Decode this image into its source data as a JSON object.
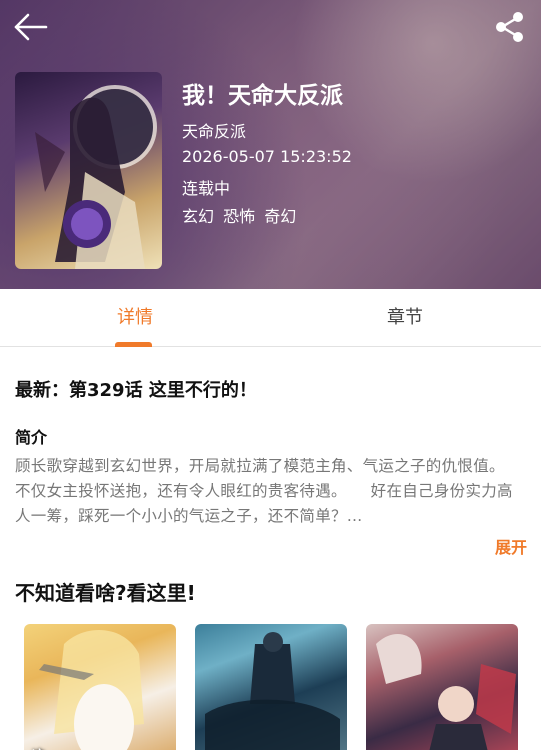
{
  "header": {
    "back_icon": "arrow-left-icon",
    "share_icon": "share-icon"
  },
  "comic": {
    "title": "我！天命大反派",
    "author": "天命反派",
    "updated": "2026-05-07 15:23:52",
    "status": "连载中",
    "tags": [
      "玄幻",
      "恐怖",
      "奇幻"
    ]
  },
  "tabs": [
    {
      "label": "详情",
      "active": true
    },
    {
      "label": "章节",
      "active": false
    }
  ],
  "details": {
    "latest": "最新：第329话 这里不行的！",
    "intro_heading": "简介",
    "intro_text": "顾长歌穿越到玄幻世界，开局就拉满了模范主角、气运之子的仇恨值。　　不仅女主投怀送抱，还有令人眼红的贵客待遇。　　好在自己身份实力高人一筹，踩死一个小小的气运之子，还不简单？…",
    "expand_label": "展开"
  },
  "recommend": {
    "heading": "不知道看啥?看这里!",
    "items": [
      {
        "cover_text": "这"
      },
      {
        "cover_text": ""
      },
      {
        "cover_text": ""
      }
    ]
  },
  "colors": {
    "accent": "#f07a2a"
  }
}
